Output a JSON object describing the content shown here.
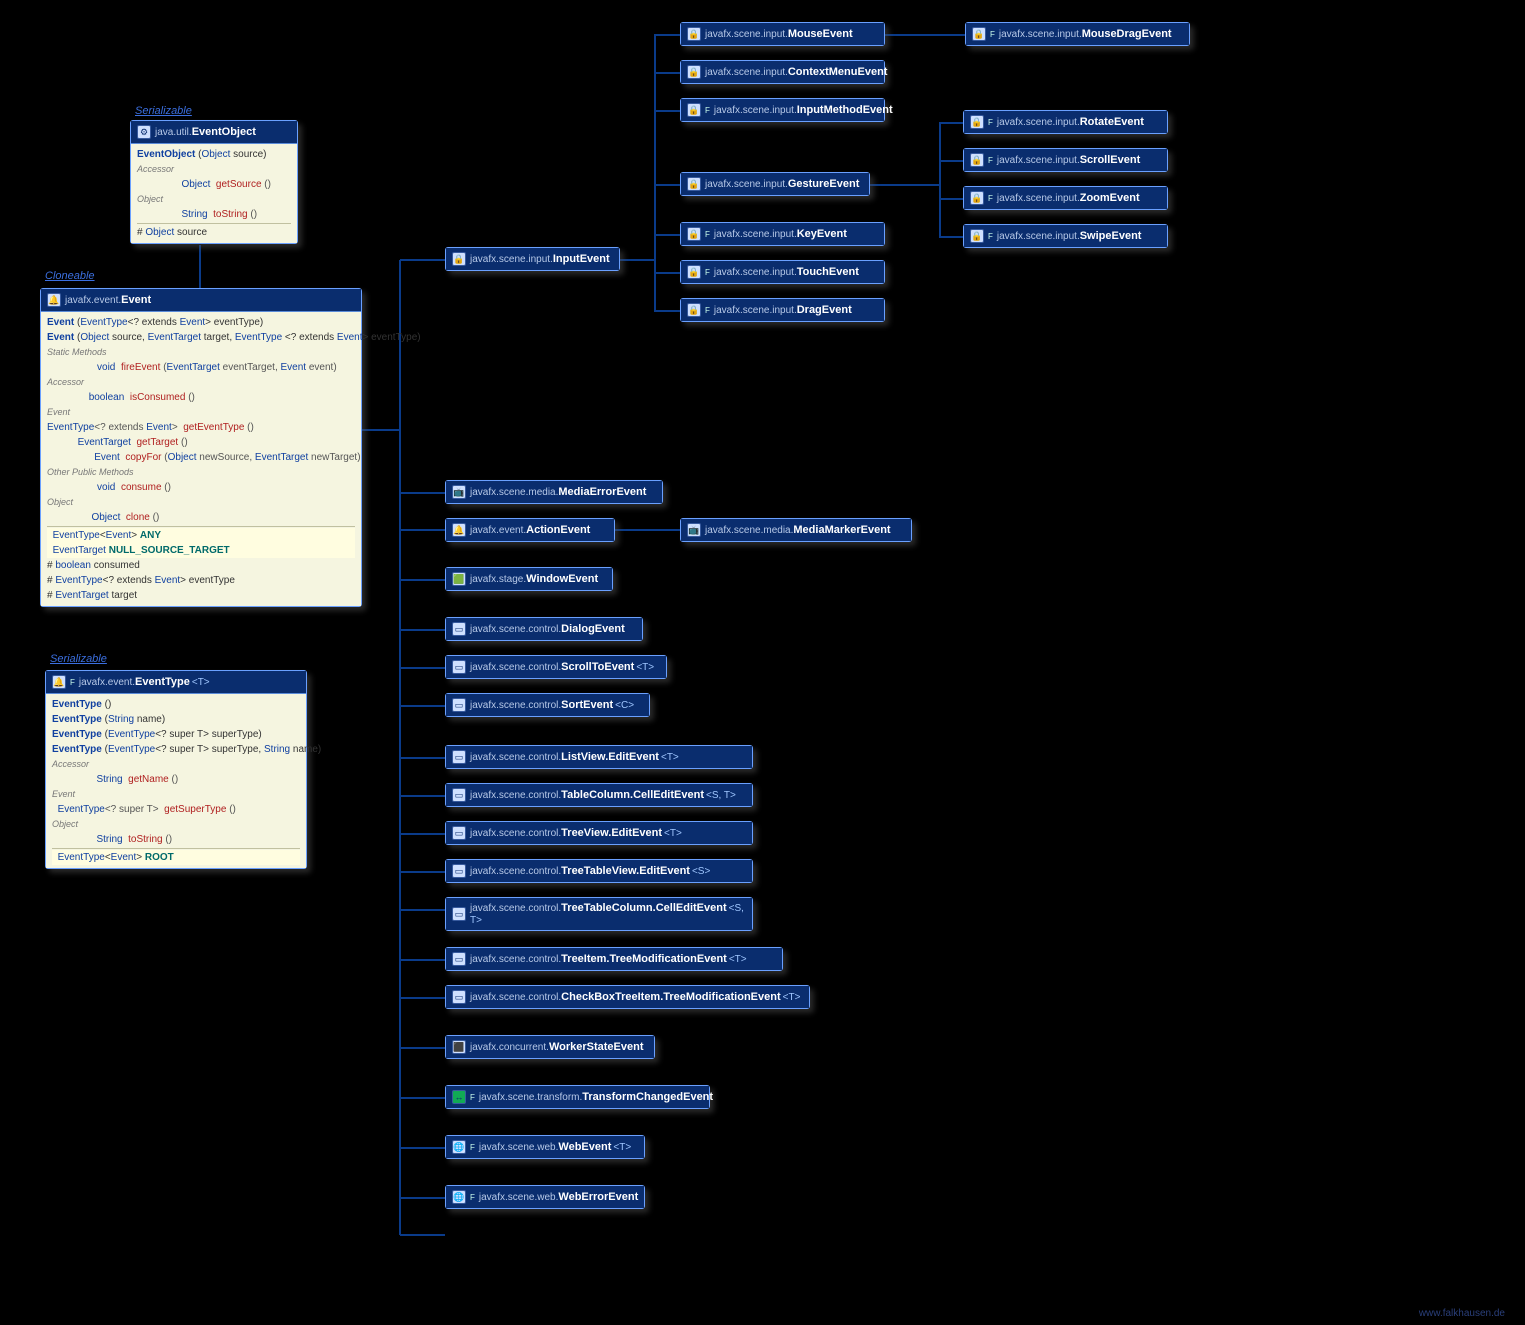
{
  "interfaces": {
    "serializable1": "Serializable",
    "cloneable": "Cloneable",
    "serializable2": "Serializable"
  },
  "footer": "www.falkhausen.de",
  "eventObject": {
    "pkg": "java.util.",
    "name": "EventObject",
    "rows": [
      {
        "t": "ctor",
        "text": "EventObject (Object source)"
      },
      {
        "t": "sh",
        "text": "Accessor"
      },
      {
        "t": "m",
        "ret": "Object",
        "name": "getSource",
        "sig": "()"
      },
      {
        "t": "sh",
        "text": "Object"
      },
      {
        "t": "m",
        "ret": "String",
        "name": "toString",
        "sig": "()"
      },
      {
        "t": "sep"
      },
      {
        "t": "f",
        "text": "# Object  source"
      }
    ]
  },
  "event": {
    "pkg": "javafx.event.",
    "name": "Event",
    "rows": [
      {
        "t": "ctor",
        "text": "Event (EventType<? extends Event> eventType)"
      },
      {
        "t": "ctor",
        "text": "Event (Object source, EventTarget target, EventType <? extends Event> eventType)"
      },
      {
        "t": "sh",
        "text": "Static Methods"
      },
      {
        "t": "m",
        "ret": "void",
        "name": "fireEvent",
        "sig": "(EventTarget eventTarget, Event event)",
        "static": true
      },
      {
        "t": "sh",
        "text": "Accessor"
      },
      {
        "t": "m",
        "ret": "boolean",
        "name": "isConsumed",
        "sig": "()"
      },
      {
        "t": "sh",
        "text": "Event"
      },
      {
        "t": "m",
        "ret": "EventType<? extends Event>",
        "name": "getEventType",
        "sig": "()"
      },
      {
        "t": "m",
        "ret": "EventTarget",
        "name": "getTarget",
        "sig": "()"
      },
      {
        "t": "m",
        "ret": "Event",
        "name": "copyFor",
        "sig": "(Object newSource, EventTarget newTarget)"
      },
      {
        "t": "sh",
        "text": "Other Public Methods"
      },
      {
        "t": "m",
        "ret": "void",
        "name": "consume",
        "sig": "()"
      },
      {
        "t": "sh",
        "text": "Object"
      },
      {
        "t": "m",
        "ret": "Object",
        "name": "clone",
        "sig": "()"
      },
      {
        "t": "sep"
      },
      {
        "t": "f",
        "text": "EventType<Event> ANY",
        "hl": true
      },
      {
        "t": "f",
        "text": "EventTarget NULL_SOURCE_TARGET",
        "hl": true
      },
      {
        "t": "f",
        "text": "# boolean consumed"
      },
      {
        "t": "f",
        "text": "# EventType<? extends Event> eventType"
      },
      {
        "t": "f",
        "text": "# EventTarget target"
      }
    ]
  },
  "eventType": {
    "pkg": "javafx.event.",
    "name": "EventType",
    "suffix": "<T>",
    "rows": [
      {
        "t": "ctor",
        "text": "EventType ()"
      },
      {
        "t": "ctor",
        "text": "EventType (String name)"
      },
      {
        "t": "ctor",
        "text": "EventType (EventType<? super T> superType)"
      },
      {
        "t": "ctor",
        "text": "EventType (EventType<? super T> superType, String name)"
      },
      {
        "t": "sh",
        "text": "Accessor"
      },
      {
        "t": "m",
        "ret": "String",
        "name": "getName",
        "sig": "()"
      },
      {
        "t": "sh",
        "text": "Event"
      },
      {
        "t": "m",
        "ret": "EventType<? super T>",
        "name": "getSuperType",
        "sig": "()"
      },
      {
        "t": "sh",
        "text": "Object"
      },
      {
        "t": "m",
        "ret": "String",
        "name": "toString",
        "sig": "()"
      },
      {
        "t": "sep"
      },
      {
        "t": "f",
        "text": "EventType<Event> ROOT",
        "hl": true
      }
    ]
  },
  "nodes": {
    "InputEvent": {
      "pkg": "javafx.scene.input.",
      "name": "InputEvent",
      "icon": "🔒"
    },
    "MouseEvent": {
      "pkg": "javafx.scene.input.",
      "name": "MouseEvent",
      "icon": "🔒"
    },
    "ContextMenuEvent": {
      "pkg": "javafx.scene.input.",
      "name": "ContextMenuEvent",
      "icon": "🔒"
    },
    "InputMethodEvent": {
      "pkg": "javafx.scene.input.",
      "name": "InputMethodEvent",
      "icon": "🔒",
      "f": "F"
    },
    "GestureEvent": {
      "pkg": "javafx.scene.input.",
      "name": "GestureEvent",
      "icon": "🔒"
    },
    "KeyEvent": {
      "pkg": "javafx.scene.input.",
      "name": "KeyEvent",
      "icon": "🔒",
      "f": "F"
    },
    "TouchEvent": {
      "pkg": "javafx.scene.input.",
      "name": "TouchEvent",
      "icon": "🔒",
      "f": "F"
    },
    "DragEvent": {
      "pkg": "javafx.scene.input.",
      "name": "DragEvent",
      "icon": "🔒",
      "f": "F"
    },
    "MouseDragEvent": {
      "pkg": "javafx.scene.input.",
      "name": "MouseDragEvent",
      "icon": "🔒",
      "f": "F"
    },
    "RotateEvent": {
      "pkg": "javafx.scene.input.",
      "name": "RotateEvent",
      "icon": "🔒",
      "f": "F"
    },
    "ScrollEvent": {
      "pkg": "javafx.scene.input.",
      "name": "ScrollEvent",
      "icon": "🔒",
      "f": "F"
    },
    "ZoomEvent": {
      "pkg": "javafx.scene.input.",
      "name": "ZoomEvent",
      "icon": "🔒",
      "f": "F"
    },
    "SwipeEvent": {
      "pkg": "javafx.scene.input.",
      "name": "SwipeEvent",
      "icon": "🔒",
      "f": "F"
    },
    "MediaErrorEvent": {
      "pkg": "javafx.scene.media.",
      "name": "MediaErrorEvent",
      "icon": "📺"
    },
    "ActionEvent": {
      "pkg": "javafx.event.",
      "name": "ActionEvent",
      "icon": "🔔"
    },
    "MediaMarkerEvent": {
      "pkg": "javafx.scene.media.",
      "name": "MediaMarkerEvent",
      "icon": "📺"
    },
    "WindowEvent": {
      "pkg": "javafx.stage.",
      "name": "WindowEvent",
      "icon": "🟩"
    },
    "DialogEvent": {
      "pkg": "javafx.scene.control.",
      "name": "DialogEvent",
      "icon": "▭"
    },
    "ScrollToEvent": {
      "pkg": "javafx.scene.control.",
      "name": "ScrollToEvent",
      "suffix": "<T>",
      "icon": "▭"
    },
    "SortEvent": {
      "pkg": "javafx.scene.control.",
      "name": "SortEvent",
      "suffix": "<C>",
      "icon": "▭"
    },
    "ListViewEdit": {
      "pkg": "javafx.scene.control.",
      "name": "ListView.EditEvent",
      "suffix": "<T>",
      "icon": "▭"
    },
    "TableColumnEdit": {
      "pkg": "javafx.scene.control.",
      "name": "TableColumn.CellEditEvent",
      "suffix": "<S, T>",
      "icon": "▭"
    },
    "TreeViewEdit": {
      "pkg": "javafx.scene.control.",
      "name": "TreeView.EditEvent",
      "suffix": "<T>",
      "icon": "▭"
    },
    "TreeTableViewEdit": {
      "pkg": "javafx.scene.control.",
      "name": "TreeTableView.EditEvent",
      "suffix": "<S>",
      "icon": "▭"
    },
    "TreeTableColumnEdit": {
      "pkg": "javafx.scene.control.",
      "name": "TreeTableColumn.CellEditEvent",
      "suffix": "<S, T>",
      "icon": "▭"
    },
    "TreeItemMod": {
      "pkg": "javafx.scene.control.",
      "name": "TreeItem.TreeModificationEvent",
      "suffix": "<T>",
      "icon": "▭"
    },
    "CheckBoxTreeItemMod": {
      "pkg": "javafx.scene.control.",
      "name": "CheckBoxTreeItem.TreeModificationEvent",
      "suffix": "<T>",
      "icon": "▭"
    },
    "WorkerStateEvent": {
      "pkg": "javafx.concurrent.",
      "name": "WorkerStateEvent",
      "icon": "⬛"
    },
    "TransformChangedEvent": {
      "pkg": "javafx.scene.transform.",
      "name": "TransformChangedEvent",
      "icon": "↔",
      "f": "F",
      "green": true
    },
    "WebEvent": {
      "pkg": "javafx.scene.web.",
      "name": "WebEvent",
      "suffix": "<T>",
      "icon": "🌐",
      "f": "F"
    },
    "WebErrorEvent": {
      "pkg": "javafx.scene.web.",
      "name": "WebErrorEvent",
      "icon": "🌐",
      "f": "F"
    }
  }
}
